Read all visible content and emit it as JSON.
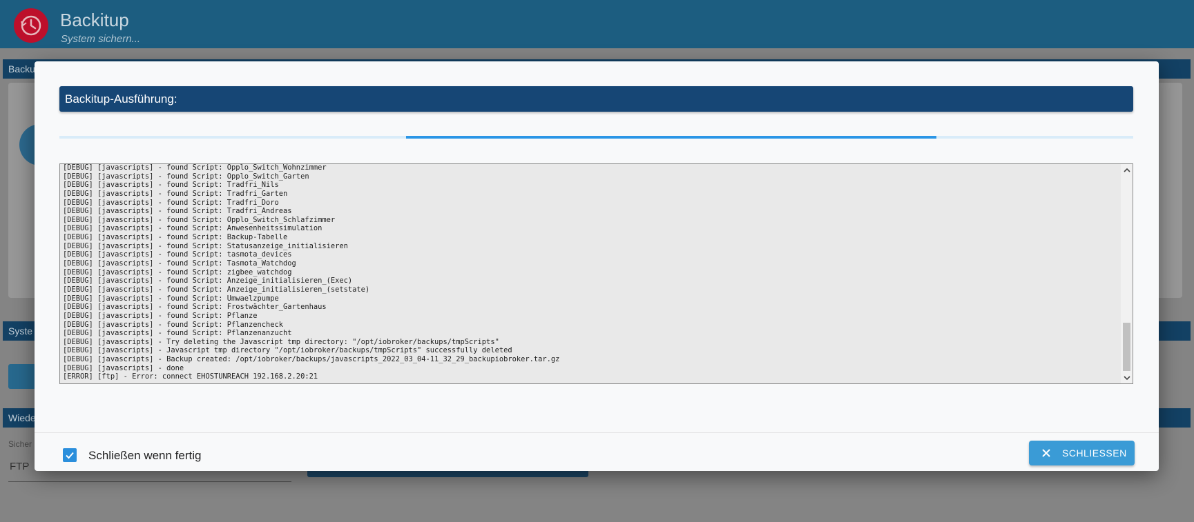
{
  "app": {
    "title": "Backitup",
    "subtitle": "System sichern...",
    "brand_color": "#1e6287",
    "logo_icon": "clock-history-icon"
  },
  "background": {
    "section1_label": "Backu",
    "section2_label": "Syste",
    "section3_label": "Wiede",
    "storage_label": "Sicher",
    "storage_value": "FTP"
  },
  "dialog": {
    "title": "Backitup-Ausführung:",
    "progress": {
      "start": 0.323,
      "end": 0.817,
      "color": "#2b96e6"
    },
    "log_lines": [
      "[DEBUG] [javascripts] - found Script: Opplo_Switch_Wohnzimmer",
      "[DEBUG] [javascripts] - found Script: Opplo_Switch_Garten",
      "[DEBUG] [javascripts] - found Script: Tradfri_Nils",
      "[DEBUG] [javascripts] - found Script: Tradfri_Garten",
      "[DEBUG] [javascripts] - found Script: Tradfri_Doro",
      "[DEBUG] [javascripts] - found Script: Tradfri_Andreas",
      "[DEBUG] [javascripts] - found Script: Opplo_Switch_Schlafzimmer",
      "[DEBUG] [javascripts] - found Script: Anwesenheitssimulation",
      "[DEBUG] [javascripts] - found Script: Backup-Tabelle",
      "[DEBUG] [javascripts] - found Script: Statusanzeige_initialisieren",
      "[DEBUG] [javascripts] - found Script: tasmota_devices",
      "[DEBUG] [javascripts] - found Script: Tasmota_Watchdog",
      "[DEBUG] [javascripts] - found Script: zigbee_watchdog",
      "[DEBUG] [javascripts] - found Script: Anzeige_initialisieren_(Exec)",
      "[DEBUG] [javascripts] - found Script: Anzeige_initialisieren_(setstate)",
      "[DEBUG] [javascripts] - found Script: Umwaelzpumpe",
      "[DEBUG] [javascripts] - found Script: Frostwächter_Gartenhaus",
      "[DEBUG] [javascripts] - found Script: Pflanze",
      "[DEBUG] [javascripts] - found Script: Pflanzencheck",
      "[DEBUG] [javascripts] - found Script: Pflanzenanzucht",
      "[DEBUG] [javascripts] - Try deleting the Javascript tmp directory: \"/opt/iobroker/backups/tmpScripts\"",
      "[DEBUG] [javascripts] - Javascript tmp directory \"/opt/iobroker/backups/tmpScripts\" successfully deleted",
      "[DEBUG] [javascripts] - Backup created: /opt/iobroker/backups/javascripts_2022_03_04-11_32_29_backupiobroker.tar.gz",
      "[DEBUG] [javascripts] - done",
      "[ERROR] [ftp] - Error: connect EHOSTUNREACH 192.168.2.20:21"
    ],
    "close_when_done_label": "Schließen wenn fertig",
    "close_when_done_checked": true,
    "close_button_label": "SCHLIESSEN",
    "accent_color": "#3a9bd6",
    "header_color": "#164675"
  }
}
